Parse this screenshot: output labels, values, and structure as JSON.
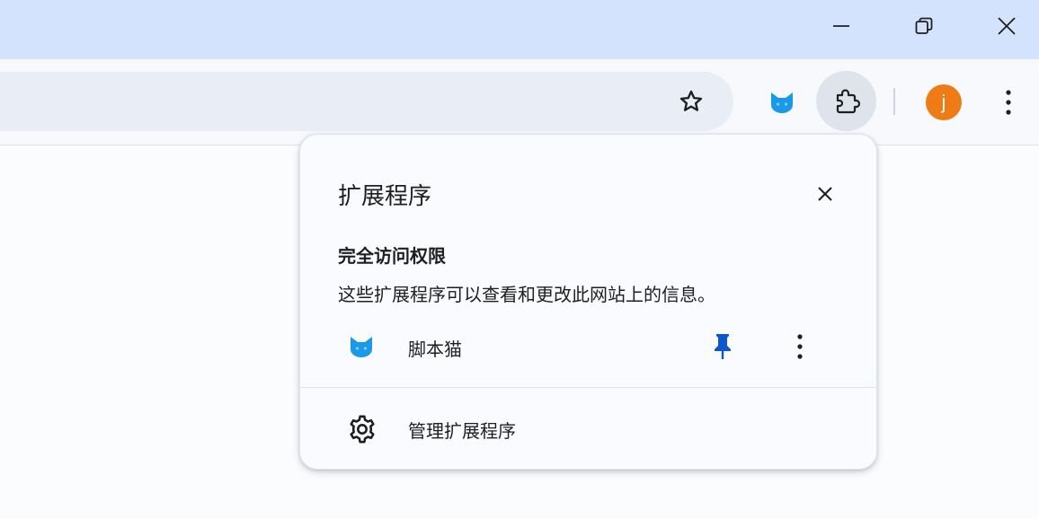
{
  "window": {
    "minimize_icon": "minimize-icon",
    "restore_icon": "restore-icon",
    "close_icon": "close-icon"
  },
  "toolbar": {
    "bookmark_icon": "star-icon",
    "pinned_extension_icon": "cat-icon",
    "extensions_icon": "puzzle-icon",
    "avatar_letter": "j",
    "avatar_color": "#ef7b16",
    "menu_icon": "vertical-dots-icon"
  },
  "extensions_popup": {
    "title": "扩展程序",
    "close_icon": "close-icon",
    "section_heading": "完全访问权限",
    "section_description": "这些扩展程序可以查看和更改此网站上的信息。",
    "extensions": [
      {
        "name": "脚本猫",
        "icon": "cat-icon",
        "pinned": true,
        "pin_icon": "pin-icon",
        "more_icon": "vertical-dots-icon"
      }
    ],
    "manage_label": "管理扩展程序",
    "manage_icon": "gear-icon"
  },
  "colors": {
    "titlebar": "#d3e3fd",
    "accent_blue": "#0b57d0",
    "extension_icon_blue": "#1a9ae6"
  }
}
